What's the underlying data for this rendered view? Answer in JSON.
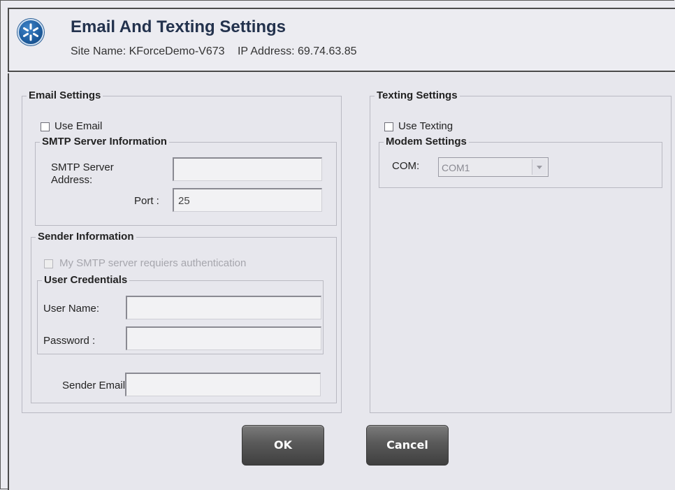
{
  "header": {
    "title": "Email And Texting Settings",
    "site_name": "Site Name: KForceDemo-V673",
    "ip_address": "IP Address: 69.74.63.85",
    "logo_icon": "asterisk-logo-icon"
  },
  "email_settings": {
    "legend": "Email Settings",
    "use_email_label": "Use Email",
    "use_email_checked": false,
    "smtp": {
      "legend": "SMTP Server Information",
      "address_label_line1": "SMTP Server",
      "address_label_line2": "Address:",
      "address_value": "",
      "port_label": "Port :",
      "port_value": "25"
    },
    "sender": {
      "legend": "Sender Information",
      "auth_label": "My SMTP server requiers authentication",
      "auth_checked": false,
      "credentials": {
        "legend": "User Credentials",
        "username_label": "User Name:",
        "username_value": "",
        "password_label": "Password :",
        "password_value": ""
      },
      "sender_email_label": "Sender Email:",
      "sender_email_value": ""
    }
  },
  "texting_settings": {
    "legend": "Texting Settings",
    "use_texting_label": "Use Texting",
    "use_texting_checked": false,
    "modem": {
      "legend": "Modem Settings",
      "com_label": "COM:",
      "com_value": "COM1"
    }
  },
  "buttons": {
    "ok": "OK",
    "cancel": "Cancel"
  }
}
